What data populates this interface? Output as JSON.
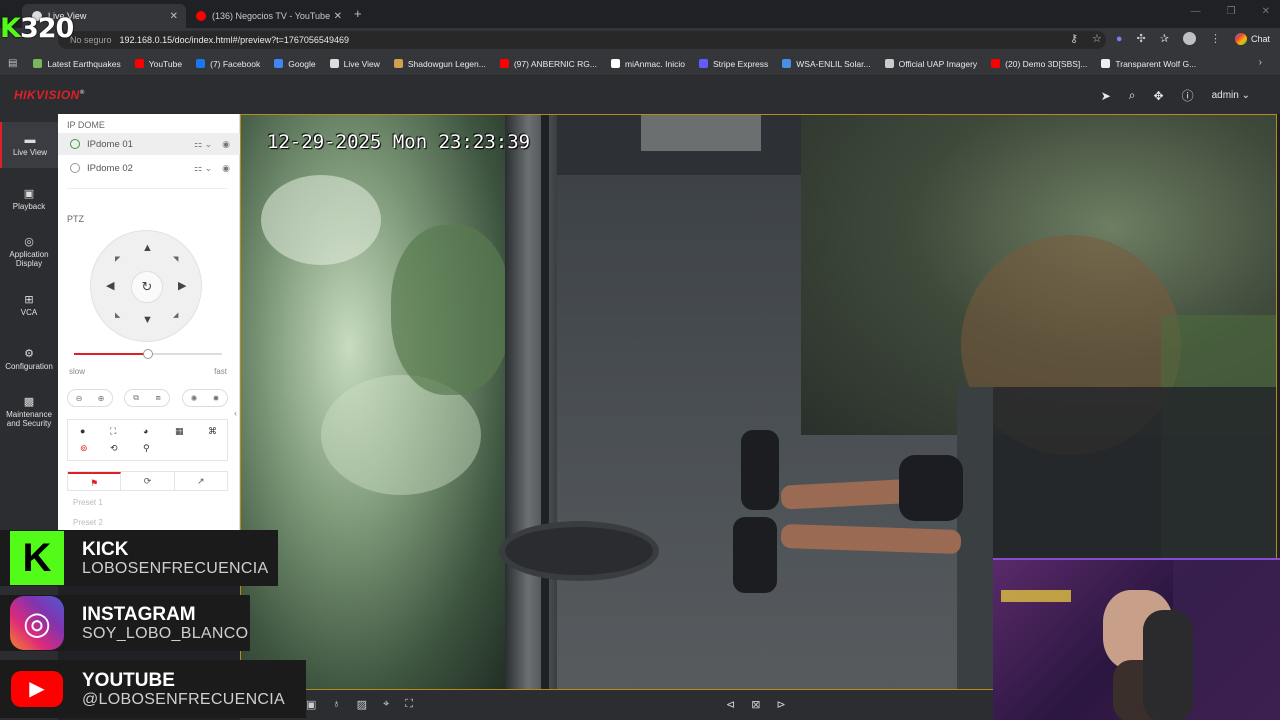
{
  "browser": {
    "tabs": [
      {
        "title": "Live View",
        "active": true
      },
      {
        "title": "(136) Negocios TV - YouTube",
        "active": false
      }
    ],
    "new_tab": "+",
    "address_prefix": "No seguro",
    "url": "192.168.0.15/doc/index.html#/preview?t=1767056549469",
    "chat_label": "Chat",
    "bookmarks": [
      {
        "label": "Latest Earthquakes",
        "color": "#7bb661"
      },
      {
        "label": "YouTube",
        "color": "#ff0000"
      },
      {
        "label": "(7) Facebook",
        "color": "#1877f2"
      },
      {
        "label": "Google",
        "color": "#4285f4"
      },
      {
        "label": "Live View",
        "color": "#dddddd"
      },
      {
        "label": "Shadowgun Legen...",
        "color": "#d0a050"
      },
      {
        "label": "(97) ANBERNIC RG...",
        "color": "#ff0000"
      },
      {
        "label": "miAnmac. Inicio",
        "color": "#ffffff"
      },
      {
        "label": "Stripe Express",
        "color": "#635bff"
      },
      {
        "label": "WSA-ENLIL Solar...",
        "color": "#4a90e2"
      },
      {
        "label": "Official UAP Imagery",
        "color": "#cccccc"
      },
      {
        "label": "(20) Demo 3D[SBS]...",
        "color": "#ff0000"
      },
      {
        "label": "Transparent Wolf G...",
        "color": "#eeeeee"
      }
    ]
  },
  "overlay_counter": {
    "prefix": "K",
    "number": "320"
  },
  "hikvision": {
    "logo": "HIKVISION",
    "logo_mark": "®",
    "user": "admin",
    "nav": [
      {
        "label": "Live View",
        "icon": "monitor-icon"
      },
      {
        "label": "Playback",
        "icon": "playback-icon"
      },
      {
        "label": "Application Display",
        "icon": "application-icon"
      },
      {
        "label": "VCA",
        "icon": "vca-icon"
      },
      {
        "label": "Configuration",
        "icon": "gear-icon"
      },
      {
        "label": "Maintenance and Security",
        "icon": "maintenance-icon"
      }
    ],
    "panel": {
      "title": "IP DOME",
      "cameras": [
        "IPdome 01",
        "IPdome 02"
      ],
      "ptz_label": "PTZ",
      "speed": {
        "slow": "slow",
        "fast": "fast",
        "value": 0.5
      },
      "tabs": [
        "preset",
        "patrol",
        "pattern"
      ],
      "presets": [
        "Preset 1",
        "Preset 2"
      ]
    },
    "video": {
      "osd_timestamp": "12-29-2025 Mon 23:23:39"
    }
  },
  "socials": [
    {
      "platform": "KICK",
      "handle": "LOBOSENFRECUENCIA",
      "color": "#53fc18"
    },
    {
      "platform": "INSTAGRAM",
      "handle": "SOY_LOBO_BLANCO",
      "color": "#e1306c"
    },
    {
      "platform": "YOUTUBE",
      "handle": "@LOBOSENFRECUENCIA",
      "color": "#ff0000"
    }
  ]
}
